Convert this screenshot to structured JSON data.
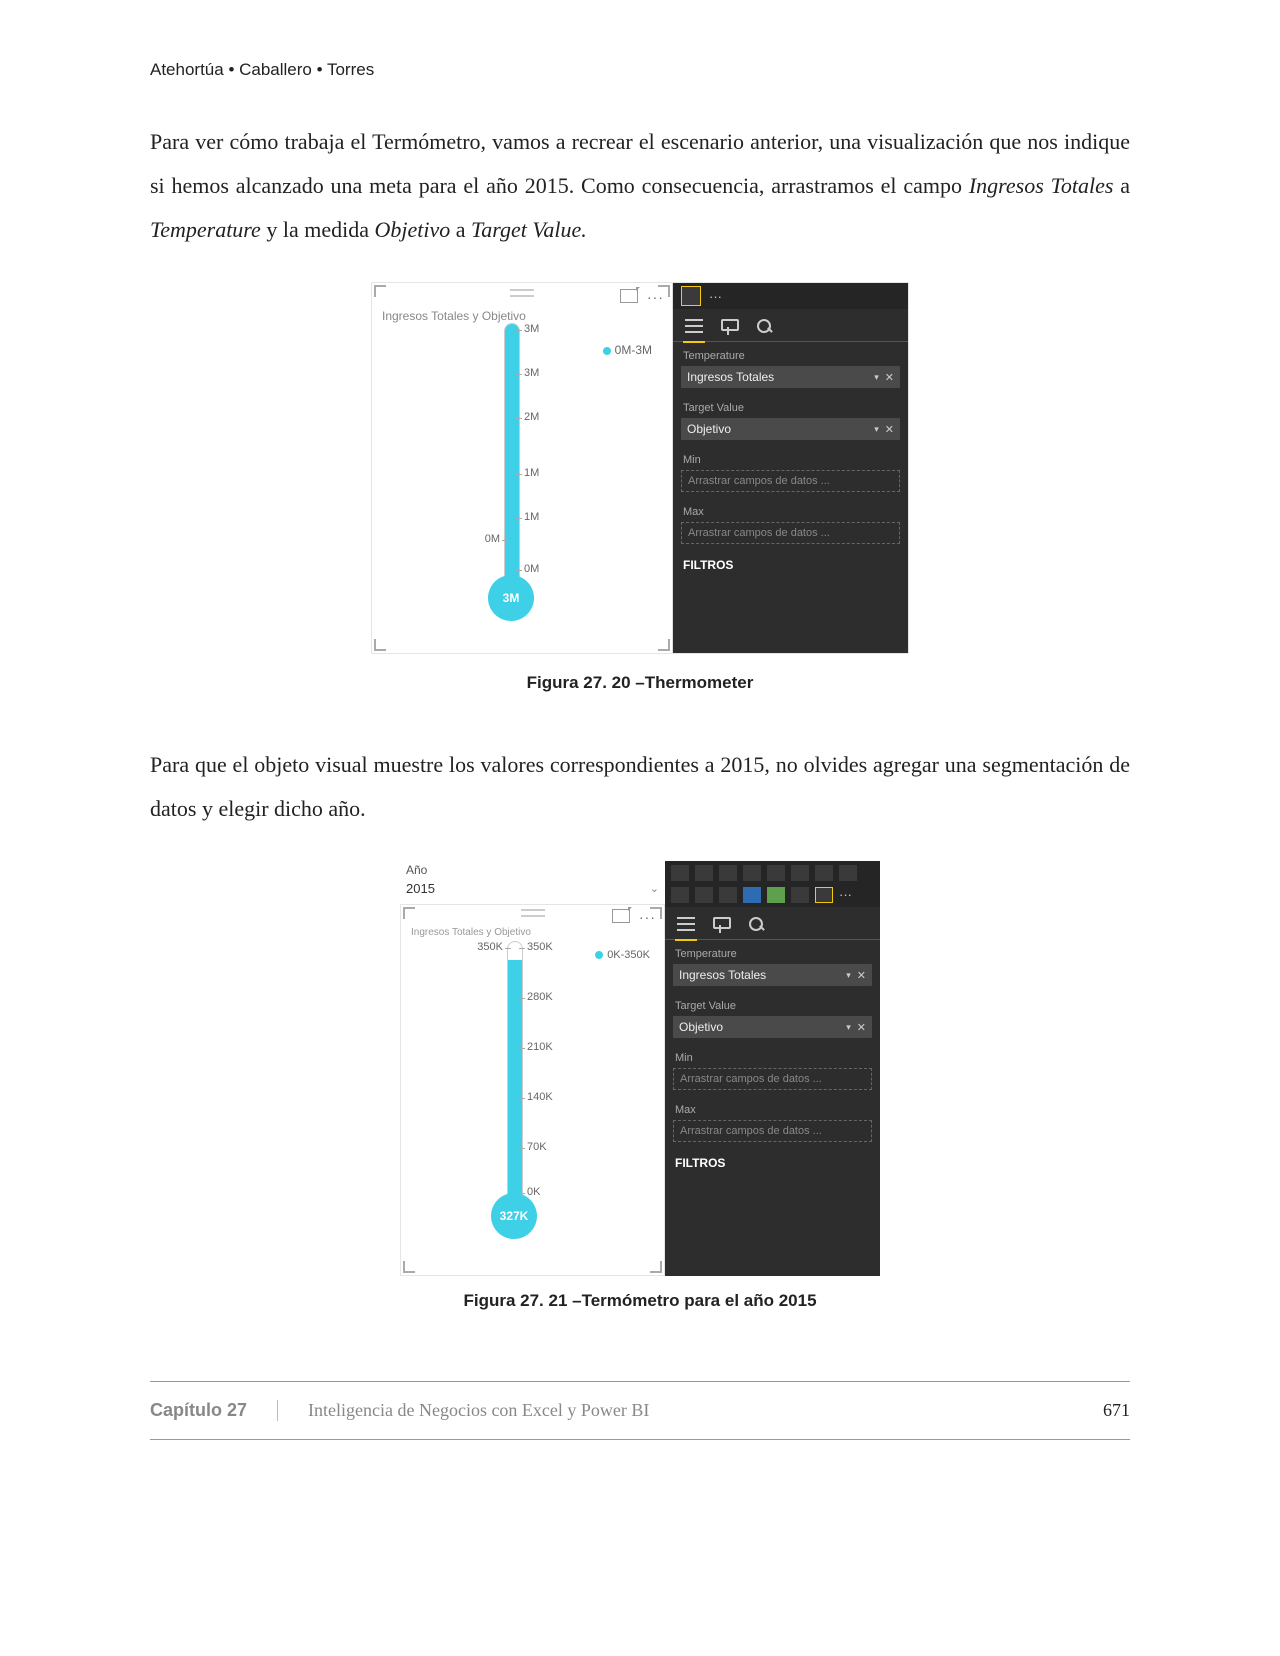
{
  "header": "Atehortúa • Caballero • Torres",
  "para1a": "Para ver cómo trabaja el Termómetro, vamos a recrear el escenario anterior, una visualización que nos indique si hemos alcanzado una meta para el año 2015. Como consecuencia, arrastramos el campo ",
  "para1i1": "Ingresos Totales",
  "para1b": " a ",
  "para1i2": "Temperature",
  "para1c": " y la medida ",
  "para1i3": "Objetivo",
  "para1d": " a ",
  "para1i4": "Target Value.",
  "fig1": {
    "title": "Ingresos Totales y Objetivo",
    "legend": "0M-3M",
    "bulb": "3M",
    "leftTick": "0M",
    "rightTicks": [
      "3M",
      "3M",
      "2M",
      "1M",
      "1M",
      "0M"
    ],
    "fillPercent": 100,
    "caption": "Figura 27. 20 –Thermometer"
  },
  "fieldsPane": {
    "sections": {
      "temperature": "Temperature",
      "tempValue": "Ingresos Totales",
      "target": "Target Value",
      "targetValue": "Objetivo",
      "min": "Min",
      "minPh": "Arrastrar campos de datos ...",
      "max": "Max",
      "maxPh": "Arrastrar campos de datos ...",
      "filtros": "FILTROS"
    }
  },
  "para2": "Para que el objeto visual muestre los valores correspondientes a 2015, no olvides agregar una segmentación de datos y elegir dicho año.",
  "fig2": {
    "slicerLabel": "Año",
    "slicerValue": "2015",
    "title": "Ingresos Totales y Objetivo",
    "legend": "0K-350K",
    "bulb": "327K",
    "leftTick": "350K",
    "rightTicks": [
      "350K",
      "280K",
      "210K",
      "140K",
      "70K",
      "0K"
    ],
    "fillPercent": 93,
    "caption": "Figura 27. 21 –Termómetro para el año 2015"
  },
  "footer": {
    "chapter": "Capítulo 27",
    "title": "Inteligencia de Negocios con Excel y Power BI",
    "page": "671"
  },
  "chart_data": [
    {
      "type": "thermometer",
      "title": "Ingresos Totales y Objetivo",
      "value": 3000000,
      "value_label": "3M",
      "target": 3000000,
      "scale_min": 0,
      "scale_max": 3000000,
      "ticks_right": [
        "3M",
        "3M",
        "2M",
        "1M",
        "1M",
        "0M"
      ],
      "indicator_label": "0M",
      "legend": "0M-3M"
    },
    {
      "type": "thermometer",
      "title": "Ingresos Totales y Objetivo",
      "filter": {
        "Año": 2015
      },
      "value": 327000,
      "value_label": "327K",
      "target": 350000,
      "scale_min": 0,
      "scale_max": 350000,
      "ticks_right": [
        "350K",
        "280K",
        "210K",
        "140K",
        "70K",
        "0K"
      ],
      "indicator_label": "350K",
      "legend": "0K-350K"
    }
  ]
}
